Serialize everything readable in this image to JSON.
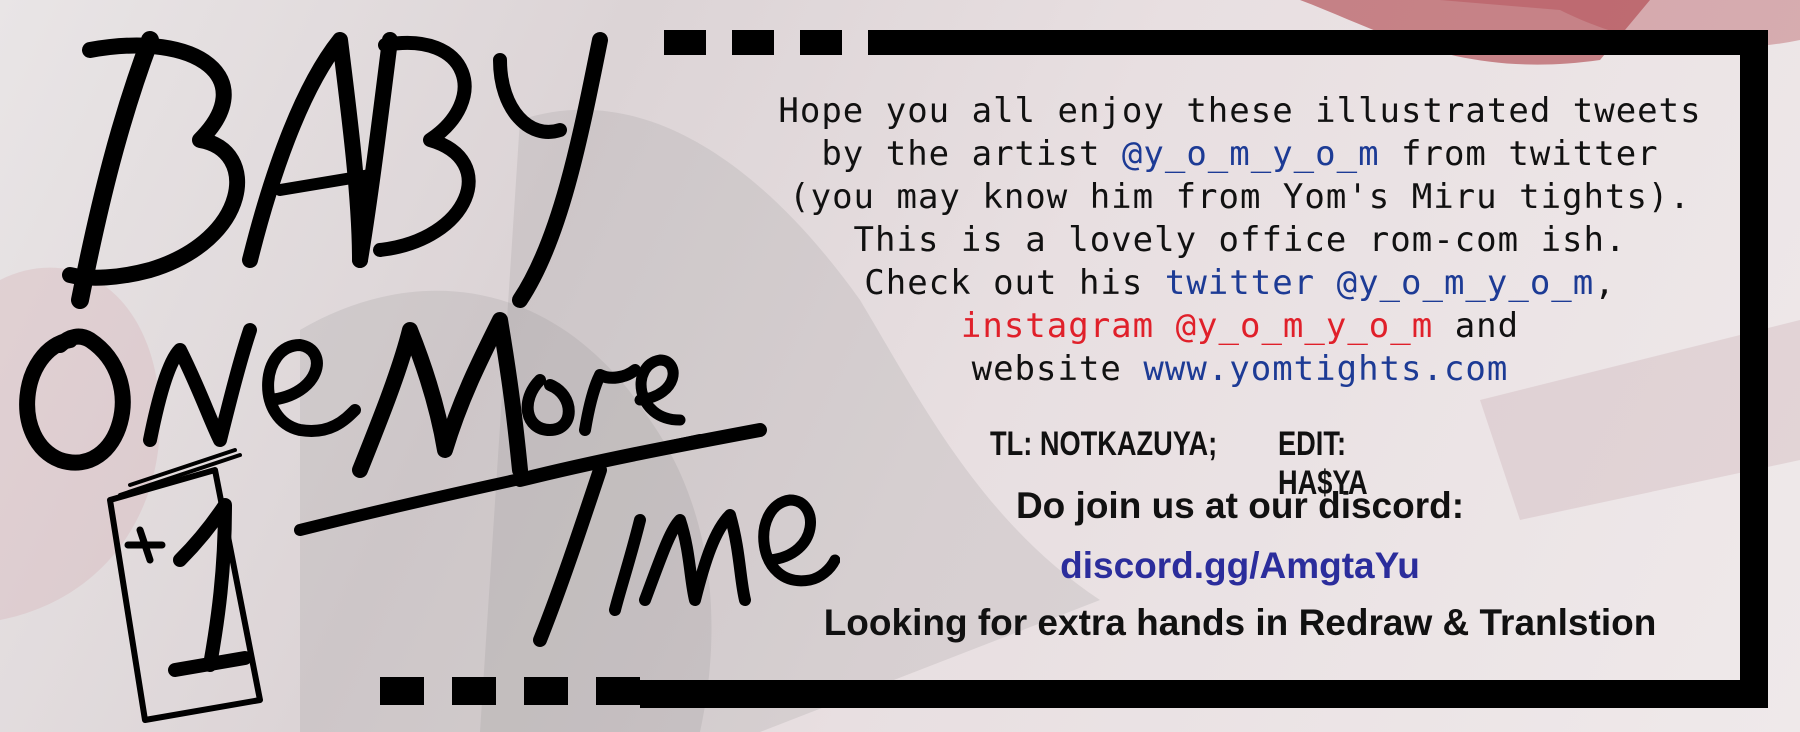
{
  "title_art": {
    "text": "Baby One More Time",
    "chapter": "+1"
  },
  "info": {
    "line1": "Hope you all enjoy these illustrated tweets",
    "line2_pre": "by the artist ",
    "line2_handle": "@y_o_m_y_o_m",
    "line2_post": " from twitter",
    "line3": "(you may know him from Yom's Miru tights).",
    "line4": "This is a lovely office rom-com ish.",
    "line5_pre": "Check out his ",
    "line5_link": "twitter @y_o_m_y_o_m",
    "line5_post": ",",
    "line6_link": "instagram @y_o_m_y_o_m",
    "line6_post": " and",
    "line7_pre": "website ",
    "line7_link": "www.yomtights.com"
  },
  "credits": {
    "tl": "TL: NOTKAZUYA;",
    "edit": "EDIT: HA$YA"
  },
  "discord": {
    "prompt": "Do join us at our discord:",
    "link": "discord.gg/AmgtaYu"
  },
  "recruit": "Looking for extra hands in Redraw & Tranlstion",
  "colors": {
    "link_blue": "#1d3b95",
    "instagram_red": "#e0202a",
    "discord_blue": "#2b2d9c"
  }
}
